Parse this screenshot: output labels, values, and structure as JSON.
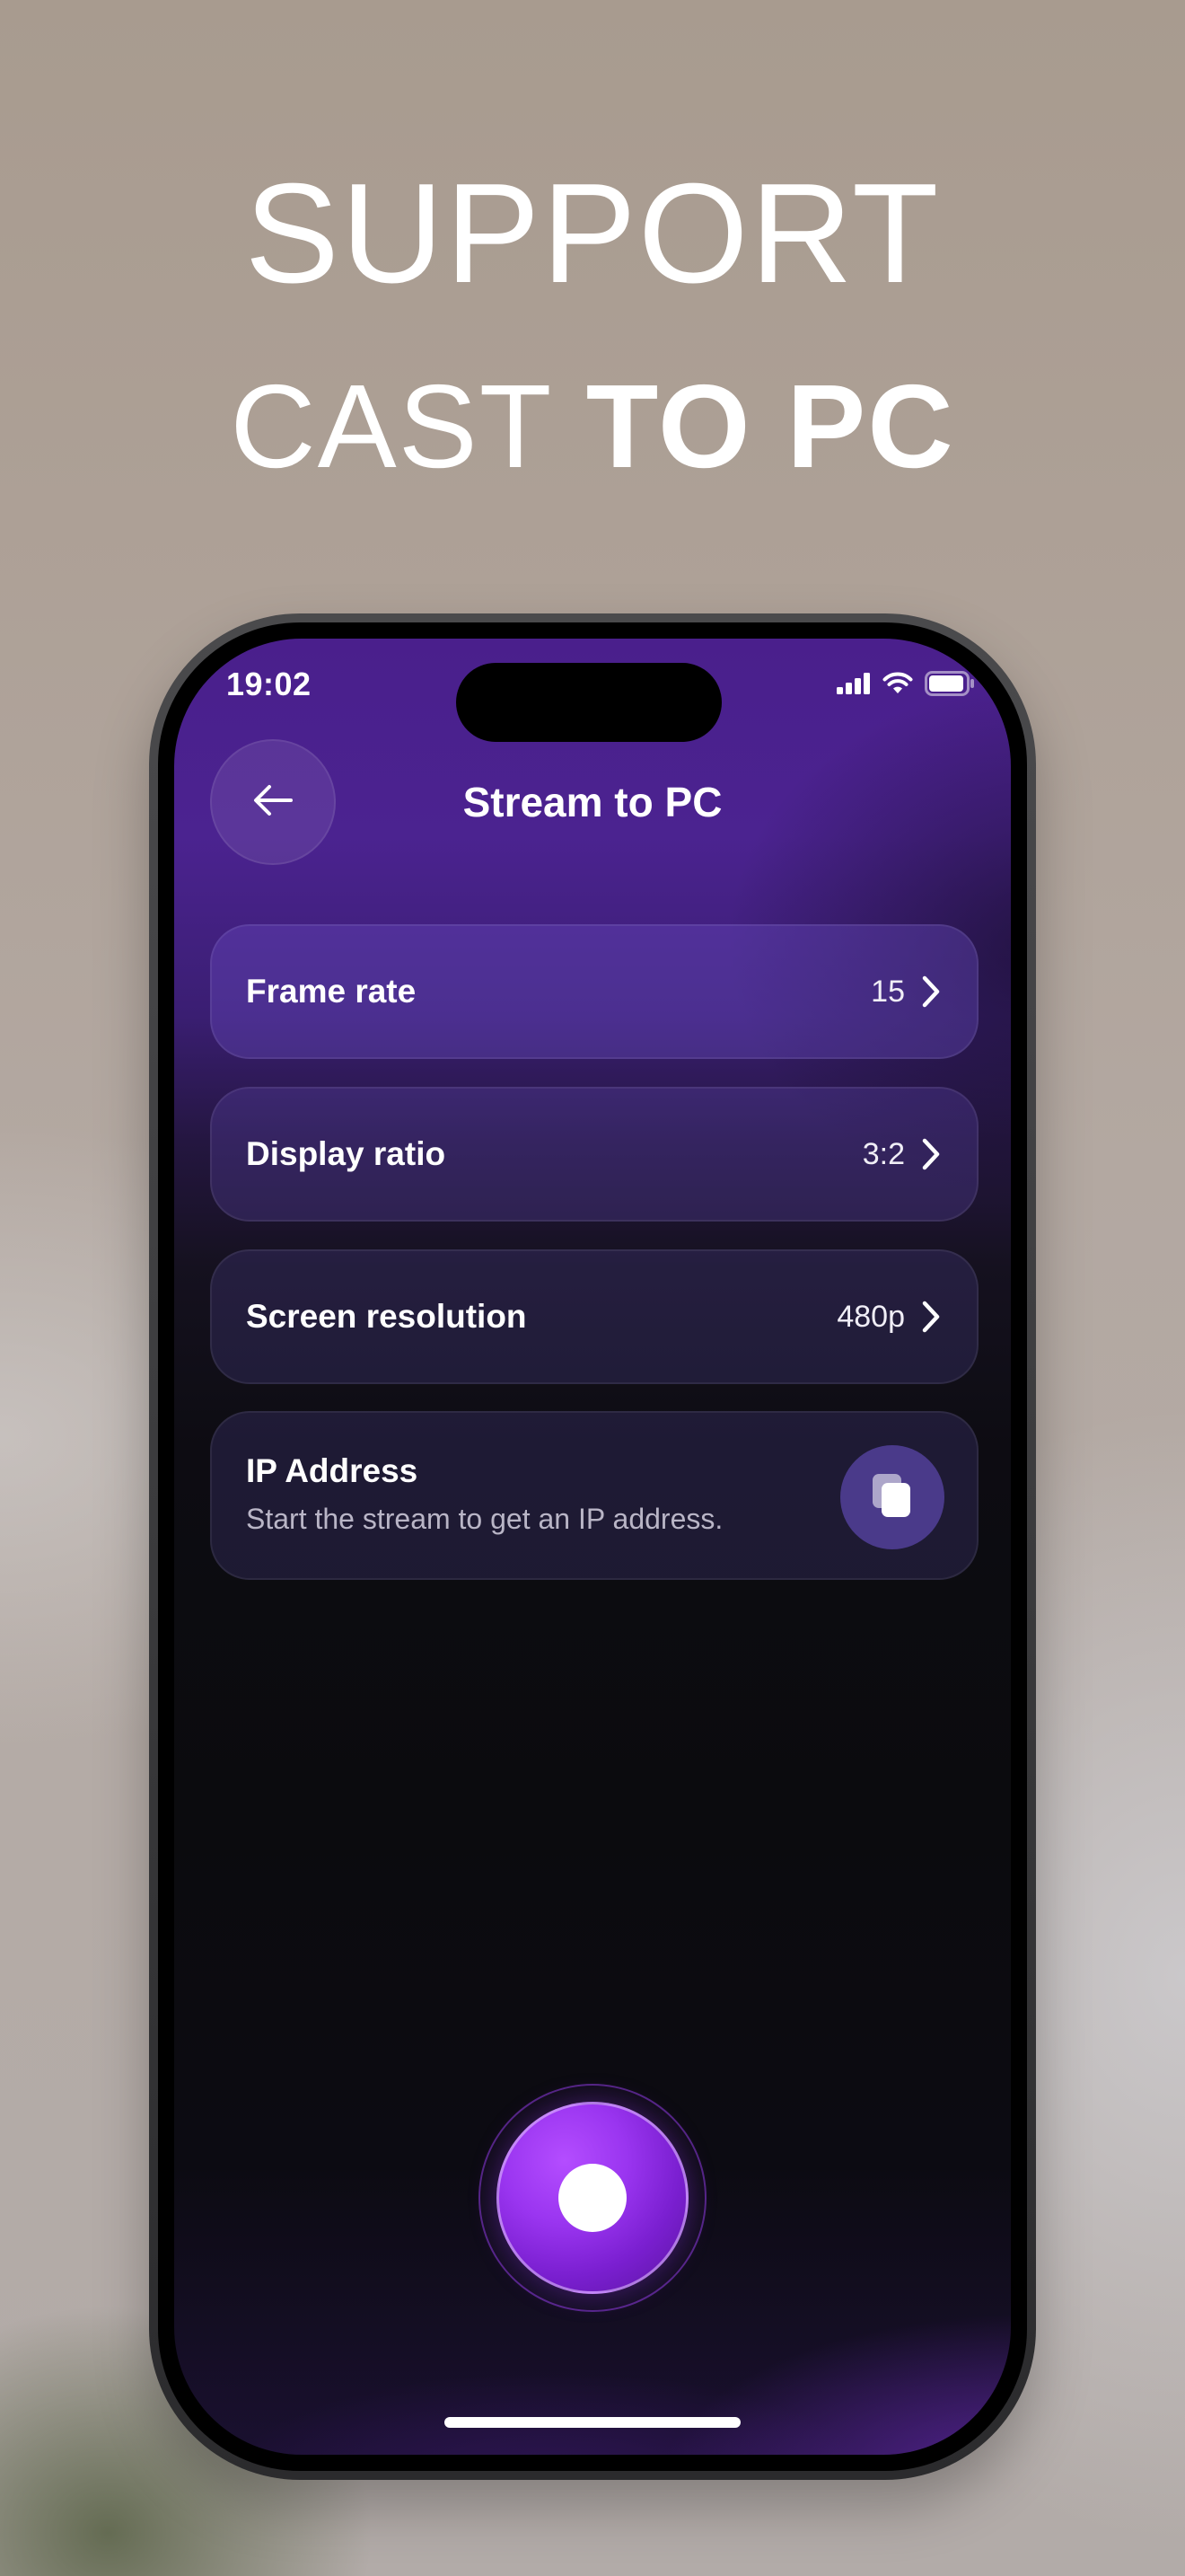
{
  "headline": {
    "line1": "SUPPORT",
    "line2_light": "CAST ",
    "line2_bold": "TO PC"
  },
  "status_bar": {
    "time": "19:02",
    "icons": [
      "cellular-signal-icon",
      "wifi-icon",
      "battery-icon"
    ]
  },
  "header": {
    "back_icon": "arrow-left-icon",
    "title": "Stream to PC"
  },
  "settings": [
    {
      "label": "Frame rate",
      "value": "15",
      "icon": "chevron-right-icon"
    },
    {
      "label": "Display ratio",
      "value": "3:2",
      "icon": "chevron-right-icon"
    },
    {
      "label": "Screen resolution",
      "value": "480p",
      "icon": "chevron-right-icon"
    }
  ],
  "ip_address": {
    "title": "IP Address",
    "subtitle": "Start the stream to get an IP address.",
    "copy_icon": "copy-icon"
  },
  "record": {
    "icon": "record-icon"
  },
  "colors": {
    "accent_purple": "#9a35f0",
    "screen_top": "#4a1f8c",
    "screen_dark": "#0b0b0e",
    "copy_button_bg": "#4a3a8a"
  }
}
